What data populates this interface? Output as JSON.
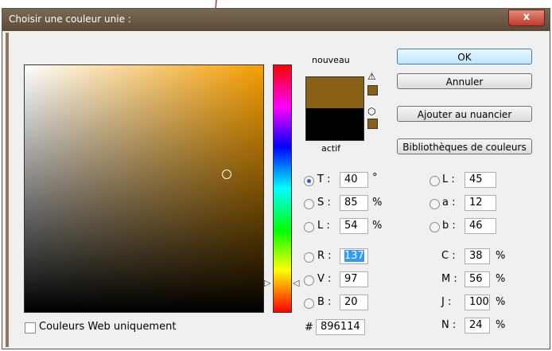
{
  "dialog": {
    "title": "Choisir une couleur unie :",
    "close_label": "x"
  },
  "preview": {
    "new_label": "nouveau",
    "current_label": "actif",
    "new_color": "#896114",
    "current_color": "#000000"
  },
  "buttons": {
    "ok": "OK",
    "cancel": "Annuler",
    "add_swatch": "Ajouter au nuancier",
    "libraries": "Bibliothèques de couleurs"
  },
  "hsb": {
    "h_label": "T :",
    "h_value": "40",
    "h_unit": "°",
    "s_label": "S :",
    "s_value": "85",
    "s_unit": "%",
    "b_label": "L :",
    "b_value": "54",
    "b_unit": "%"
  },
  "rgb": {
    "r_label": "R :",
    "r_value": "137",
    "g_label": "V :",
    "g_value": "97",
    "b_label": "B :",
    "b_value": "20"
  },
  "hex": {
    "label": "#",
    "value": "896114"
  },
  "lab": {
    "l_label": "L :",
    "l_value": "45",
    "a_label": "a :",
    "a_value": "12",
    "b_label": "b :",
    "b_value": "46"
  },
  "cmyk": {
    "c_label": "C :",
    "c_value": "38",
    "m_label": "M :",
    "m_value": "56",
    "y_label": "J :",
    "y_value": "100",
    "k_label": "N :",
    "k_value": "24",
    "unit": "%"
  },
  "web_only_label": "Couleurs Web uniquement",
  "colors": {
    "accent_arrow": "#b03a3a",
    "title_bar": "#6b5a44"
  }
}
